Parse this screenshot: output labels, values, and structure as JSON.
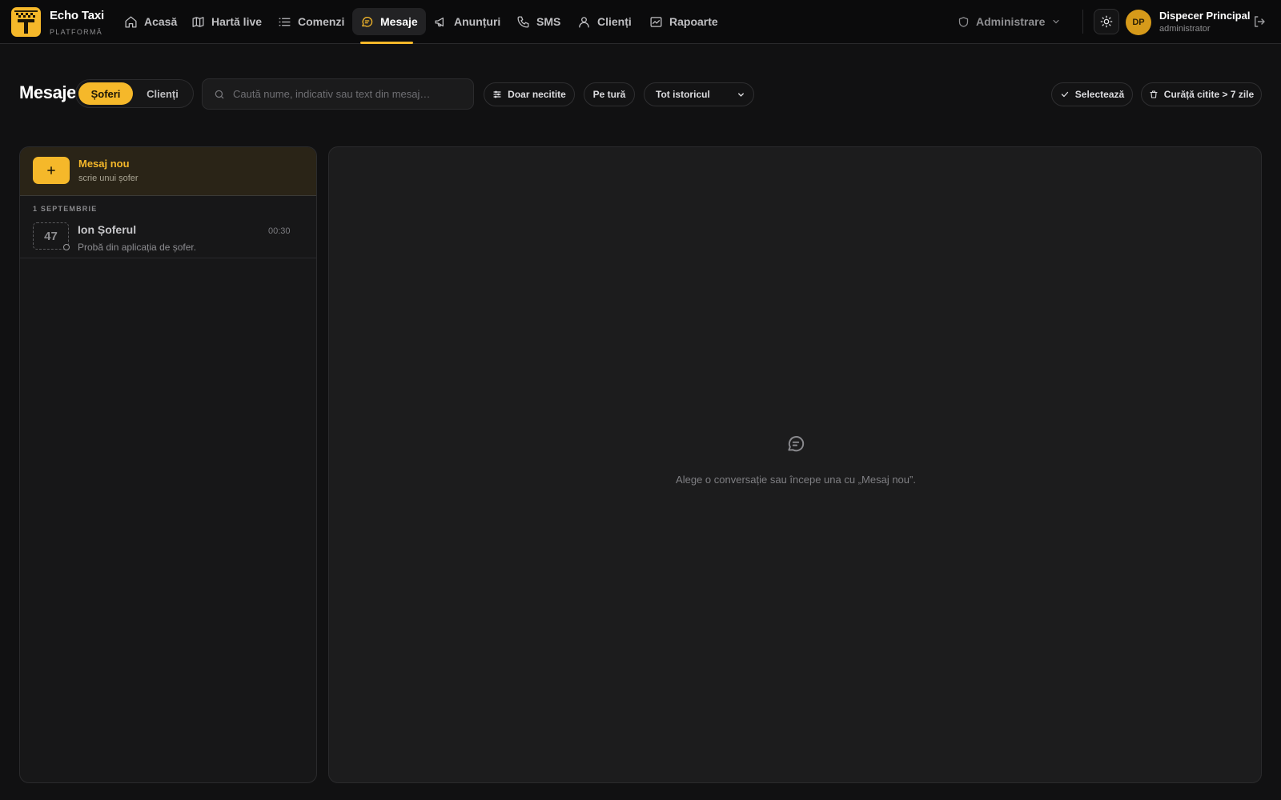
{
  "app": {
    "brand_name": "Echo Taxi",
    "brand_sub": "PLATFORMĂ",
    "accent_color": "#f5b82a"
  },
  "nav": {
    "items": [
      {
        "label": "Acasă",
        "icon": "home-icon"
      },
      {
        "label": "Hartă live",
        "icon": "map-icon"
      },
      {
        "label": "Comenzi",
        "icon": "list-icon"
      },
      {
        "label": "Mesaje",
        "icon": "chat-icon",
        "active": true
      },
      {
        "label": "Anunțuri",
        "icon": "megaphone-icon"
      },
      {
        "label": "SMS",
        "icon": "phone-icon"
      },
      {
        "label": "Clienți",
        "icon": "user-icon"
      },
      {
        "label": "Rapoarte",
        "icon": "report-icon"
      }
    ],
    "admin_label": "Administrare"
  },
  "user": {
    "initials": "DP",
    "name": "Dispecer Principal",
    "role": "administrator"
  },
  "toolbar": {
    "title": "Mesaje",
    "segments": [
      "Șoferi",
      "Clienți"
    ],
    "active_segment": "Șoferi",
    "search_placeholder": "Caută nume, indicativ sau text din mesaj…",
    "filter_unread": "Doar necitite",
    "filter_shift": "Pe tură",
    "history_select": "Tot istoricul",
    "select_label": "Selectează",
    "clean_label": "Curăță citite > 7 zile"
  },
  "sidebar": {
    "new_message_title": "Mesaj nou",
    "new_message_sub": "scrie unui șofer",
    "groups": [
      {
        "date": "1 SEPTEMBRIE",
        "conversations": [
          {
            "badge": "47",
            "name": "Ion Șoferul",
            "time": "00:30",
            "preview": "Probă din aplicația de șofer."
          }
        ]
      }
    ]
  },
  "main": {
    "empty_text": "Alege o conversație sau începe una cu „Mesaj nou”."
  }
}
